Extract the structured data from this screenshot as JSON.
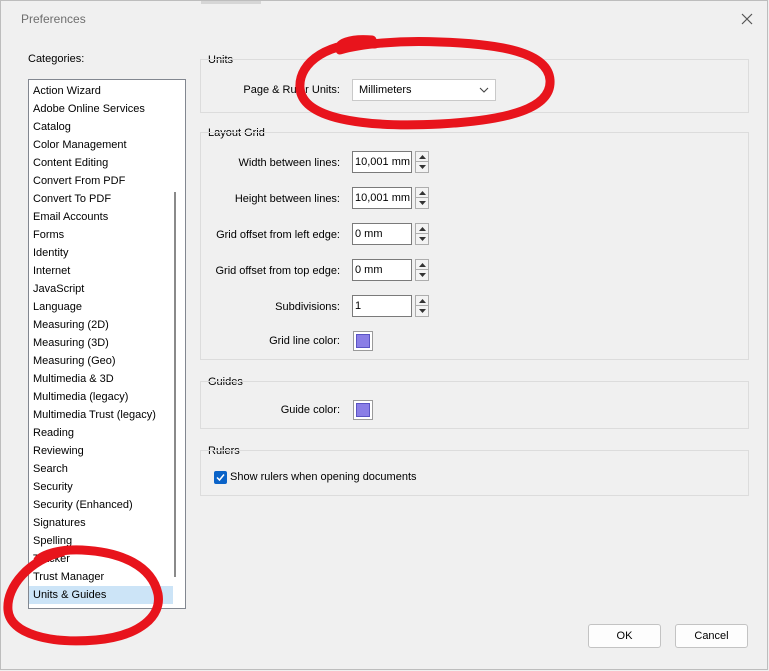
{
  "window": {
    "title": "Preferences"
  },
  "categories": {
    "label": "Categories:",
    "items": [
      "Action Wizard",
      "Adobe Online Services",
      "Catalog",
      "Color Management",
      "Content Editing",
      "Convert From PDF",
      "Convert To PDF",
      "Email Accounts",
      "Forms",
      "Identity",
      "Internet",
      "JavaScript",
      "Language",
      "Measuring (2D)",
      "Measuring (3D)",
      "Measuring (Geo)",
      "Multimedia & 3D",
      "Multimedia (legacy)",
      "Multimedia Trust (legacy)",
      "Reading",
      "Reviewing",
      "Search",
      "Security",
      "Security (Enhanced)",
      "Signatures",
      "Spelling",
      "Tracker",
      "Trust Manager",
      "Units & Guides"
    ],
    "selected": "Units & Guides"
  },
  "units": {
    "group_title": "Units",
    "page_ruler_label": "Page & Ruler Units:",
    "page_ruler_value": "Millimeters"
  },
  "layout_grid": {
    "group_title": "Layout Grid",
    "width_label": "Width between lines:",
    "width_value": "10,001 mm",
    "height_label": "Height between lines:",
    "height_value": "10,001 mm",
    "offset_left_label": "Grid offset from left edge:",
    "offset_left_value": "0 mm",
    "offset_top_label": "Grid offset from top edge:",
    "offset_top_value": "0 mm",
    "subdivisions_label": "Subdivisions:",
    "subdivisions_value": "1",
    "line_color_label": "Grid line color:",
    "line_color": "#8a7ee6"
  },
  "guides": {
    "group_title": "Guides",
    "color_label": "Guide color:",
    "color": "#8a7ee6"
  },
  "rulers": {
    "group_title": "Rulers",
    "show_rulers_label": "Show rulers when opening documents",
    "show_rulers_checked": true
  },
  "buttons": {
    "ok": "OK",
    "cancel": "Cancel"
  },
  "colors": {
    "accent": "#0a63c8",
    "selection": "#cce4f7",
    "annotation_red": "#e8141c"
  }
}
